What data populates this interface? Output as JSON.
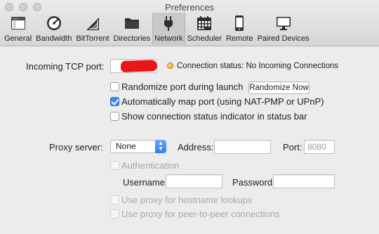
{
  "window": {
    "title": "Preferences"
  },
  "toolbar": {
    "items": [
      {
        "label": "General",
        "icon": "general-icon"
      },
      {
        "label": "Bandwidth",
        "icon": "speedometer-icon"
      },
      {
        "label": "BitTorrent",
        "icon": "bittorrent-icon"
      },
      {
        "label": "Directories",
        "icon": "folder-icon"
      },
      {
        "label": "Network",
        "icon": "plug-icon",
        "active": true
      },
      {
        "label": "Scheduler",
        "icon": "calendar-icon"
      },
      {
        "label": "Remote",
        "icon": "phone-icon"
      },
      {
        "label": "Paired Devices",
        "icon": "monitor-icon"
      }
    ]
  },
  "network": {
    "incoming_port_label": "Incoming TCP port:",
    "incoming_port_value": "",
    "connection_status": "Connection status: No Incoming Connections",
    "randomize_port": {
      "label": "Randomize port during launch",
      "checked": false
    },
    "randomize_now_button": "Randomize Now",
    "auto_map_port": {
      "label": "Automatically map port (using NAT-PMP or UPnP)",
      "checked": true
    },
    "show_status_indicator": {
      "label": "Show connection status indicator in status bar",
      "checked": false
    }
  },
  "proxy": {
    "server_label": "Proxy server:",
    "server_value": "None",
    "address_label": "Address:",
    "address_value": "",
    "port_label": "Port:",
    "port_placeholder": "8080",
    "authentication": {
      "label": "Authentication",
      "checked": false,
      "enabled": false
    },
    "username_label": "Username:",
    "username_value": "",
    "password_label": "Password:",
    "password_value": "",
    "hostname_lookups": {
      "label": "Use proxy for hostname lookups",
      "checked": false,
      "enabled": false
    },
    "peer_connections": {
      "label": "Use proxy for peer-to-peer connections",
      "checked": false,
      "enabled": false
    }
  }
}
